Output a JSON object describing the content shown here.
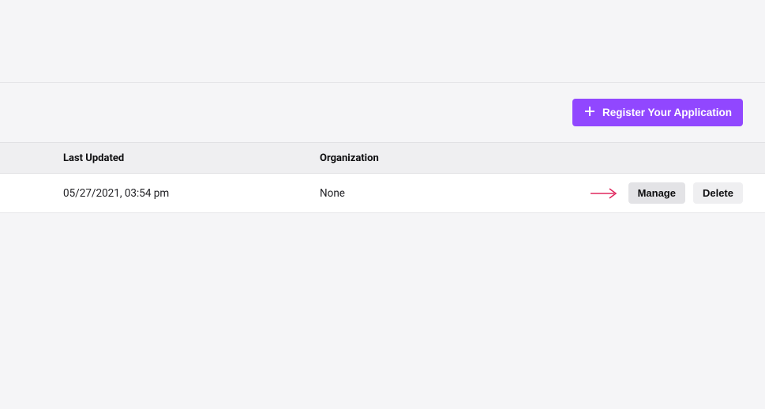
{
  "actions": {
    "register_label": "Register Your Application"
  },
  "table": {
    "headers": {
      "last_updated": "Last Updated",
      "organization": "Organization"
    },
    "rows": [
      {
        "last_updated": "05/27/2021, 03:54 pm",
        "organization": "None",
        "manage_label": "Manage",
        "delete_label": "Delete"
      }
    ]
  },
  "colors": {
    "accent": "#9147ff",
    "annotation": "#e0295f"
  }
}
